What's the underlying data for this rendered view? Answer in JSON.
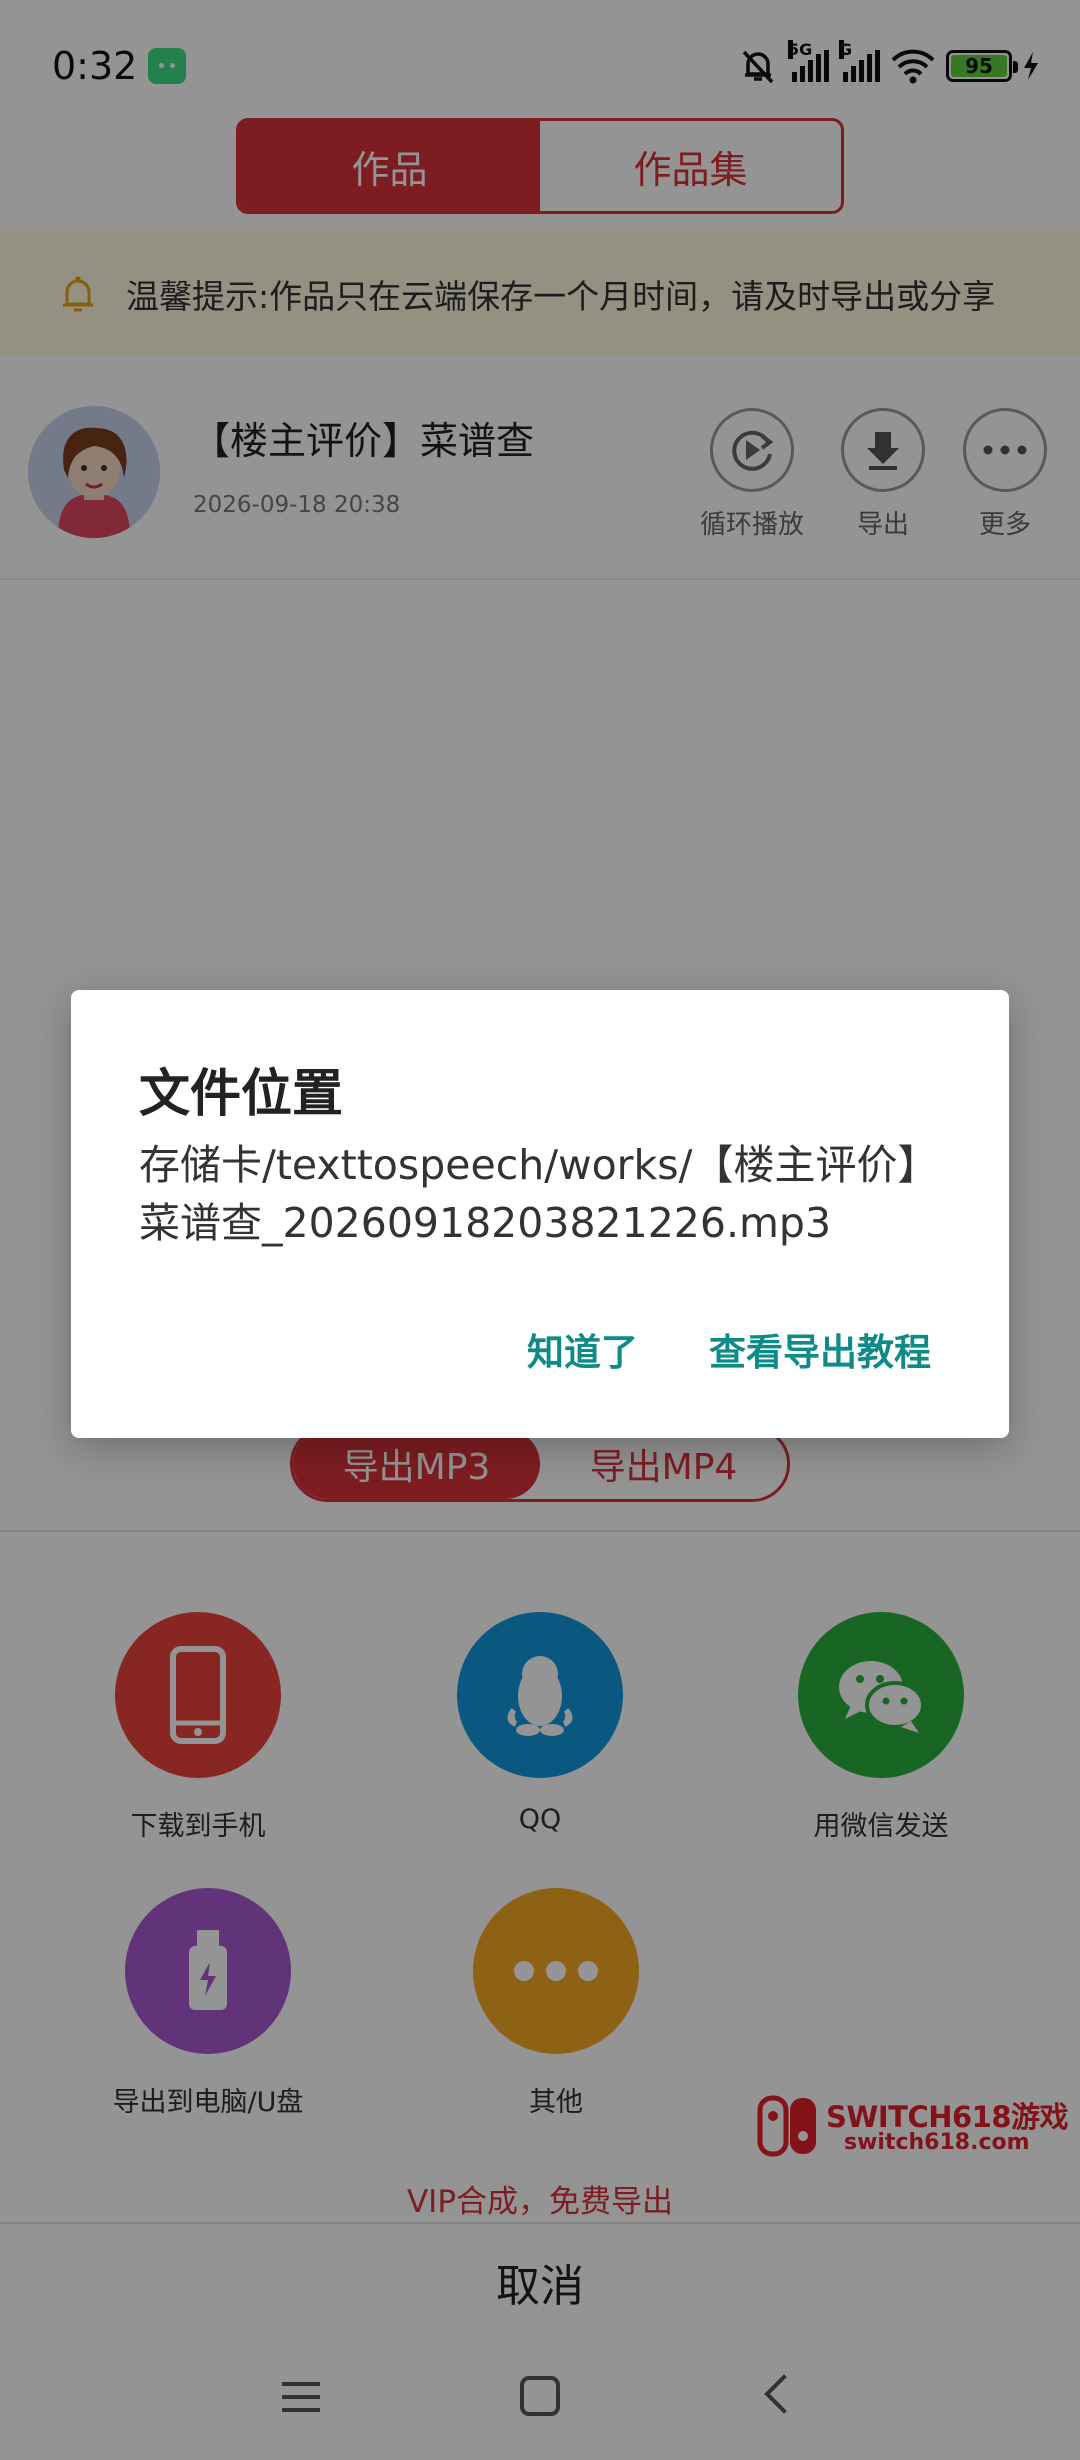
{
  "status_bar": {
    "time": "0:32",
    "network_1": "5G",
    "network_2": "G",
    "battery_level": "95"
  },
  "top_tabs": [
    "作品",
    "作品集"
  ],
  "notice": {
    "text": "温馨提示:作品只在云端保存一个月时间，请及时导出或分享"
  },
  "work_item": {
    "title": "【楼主评价】菜谱查",
    "date": "2026-09-18 20:38",
    "actions": {
      "loop": "循环播放",
      "export": "导出",
      "more": "更多"
    }
  },
  "export_sheet": {
    "format_tabs": [
      "导出MP3",
      "导出MP4"
    ],
    "share_options": {
      "phone": "下载到手机",
      "qq": "QQ",
      "wechat": "用微信发送",
      "usb": "导出到电脑/U盘",
      "other": "其他"
    },
    "vip_text": "VIP合成，免费导出",
    "cancel": "取消"
  },
  "watermark": {
    "title": "SWITCH618游戏",
    "url": "switch618.com"
  },
  "dialog": {
    "title": "文件位置",
    "body": "存储卡/texttospeech/works/【楼主评价】菜谱查_20260918203821226.mp3",
    "ok_button": "知道了",
    "tutorial_button": "查看导出教程"
  },
  "colors": {
    "brand_red": "#d9333a",
    "dialog_accent": "#0e8a88",
    "phone_icon_bg": "#e8423c",
    "qq_icon_bg": "#1296db",
    "wechat_icon_bg": "#2aae3f",
    "usb_icon_bg": "#a85ad1",
    "other_icon_bg": "#f3a925"
  }
}
